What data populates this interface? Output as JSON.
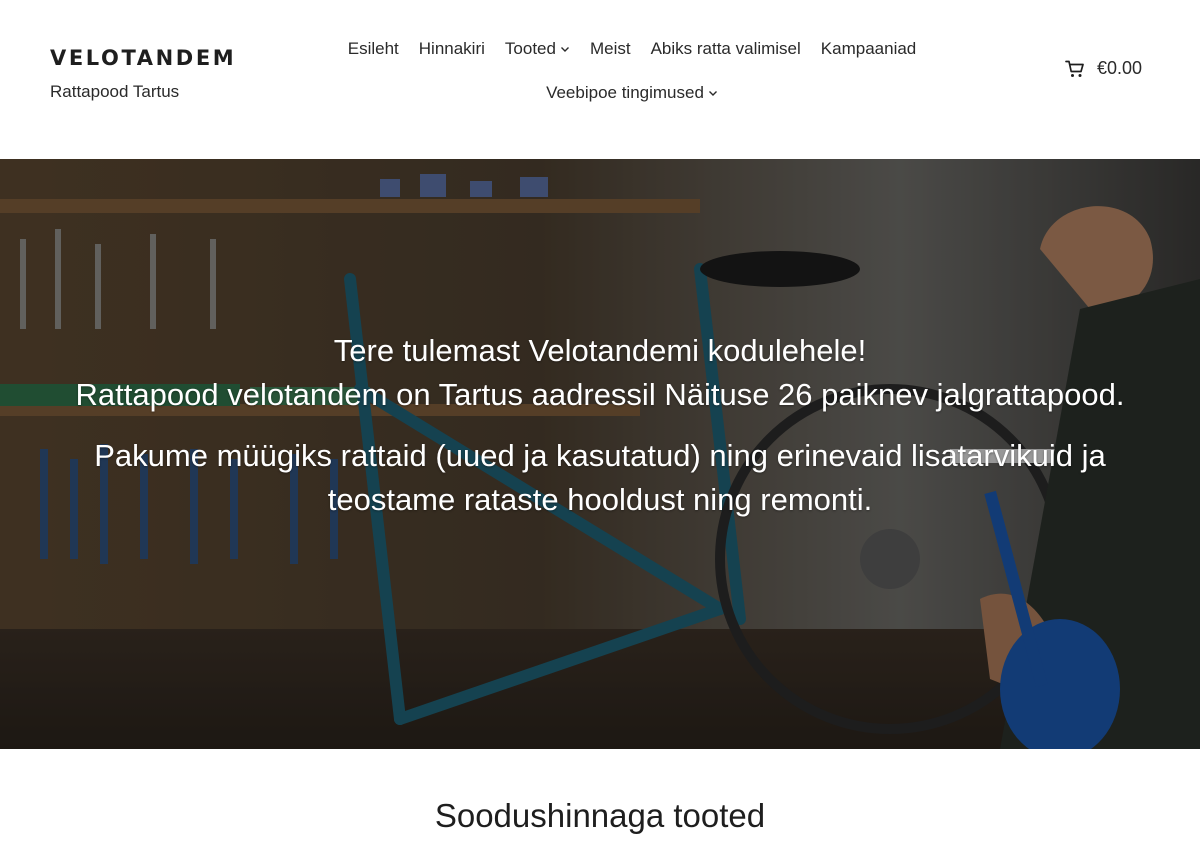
{
  "site": {
    "title": "VELOTANDEM",
    "tagline": "Rattapood Tartus"
  },
  "nav": {
    "row1": [
      {
        "label": "Esileht",
        "has_dropdown": false
      },
      {
        "label": "Hinnakiri",
        "has_dropdown": false
      },
      {
        "label": "Tooted",
        "has_dropdown": true
      },
      {
        "label": "Meist",
        "has_dropdown": false
      },
      {
        "label": "Abiks ratta valimisel",
        "has_dropdown": false
      },
      {
        "label": "Kampaaniad",
        "has_dropdown": false
      }
    ],
    "row2": [
      {
        "label": "Veebipoe tingimused",
        "has_dropdown": true
      }
    ]
  },
  "cart": {
    "icon": "cart-icon",
    "total": "€0.00"
  },
  "hero": {
    "paragraph1_line1": "Tere tulemast Velotandemi kodulehele!",
    "paragraph1_line2": "Rattapood velotandem on Tartus aadressil Näituse 26 paiknev jalgrattapood.",
    "paragraph2": "Pakume müügiks rattaid (uued ja kasutatud) ning erinevaid lisatarvikuid ja teostame rataste hooldust ning remonti."
  },
  "sections": {
    "sale_title": "Soodushinnaga tooted"
  },
  "colors": {
    "text": "#1e1e1e",
    "hero_text": "#ffffff"
  }
}
